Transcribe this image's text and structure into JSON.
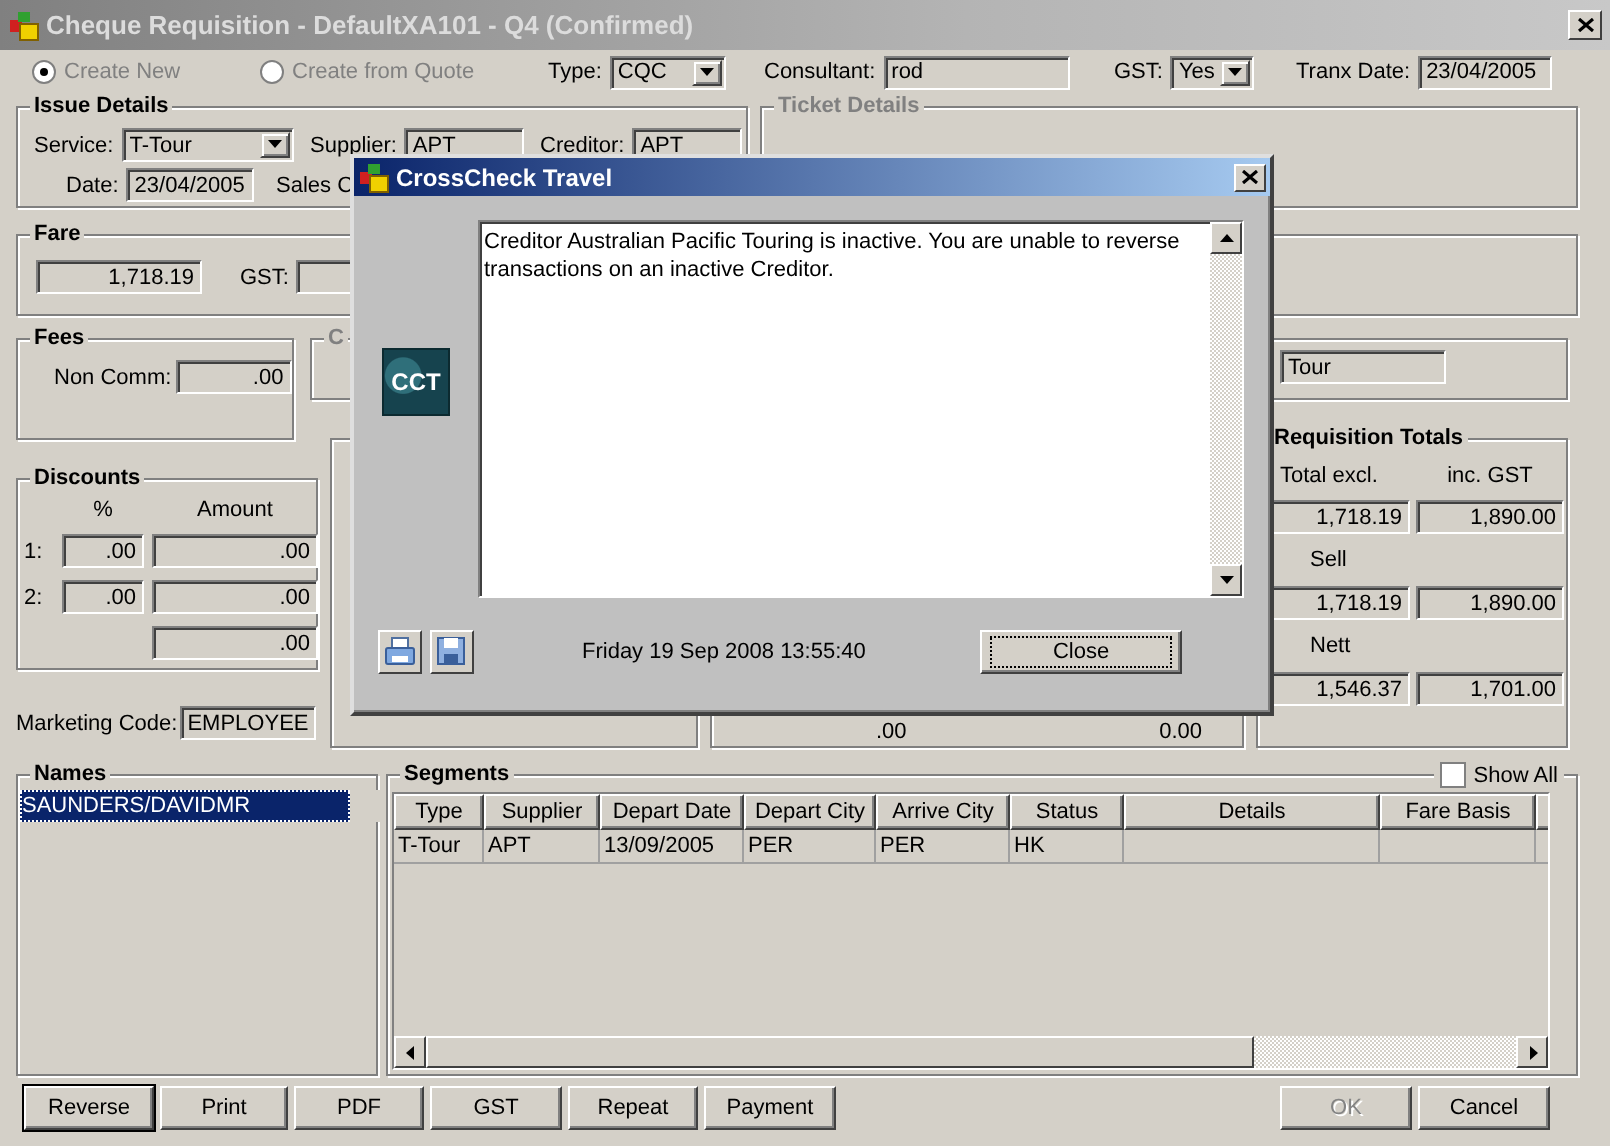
{
  "window": {
    "title": "Cheque Requisition - DefaultXA101 - Q4 (Confirmed)"
  },
  "mode_options": [
    {
      "label": "Create New",
      "selected": true
    },
    {
      "label": "Create from Quote",
      "selected": false
    }
  ],
  "header_fields": [
    {
      "label": "Type:",
      "value": "CQC",
      "kind": "dropdown"
    },
    {
      "label": "Consultant:",
      "value": "rod",
      "kind": "text"
    },
    {
      "label": "GST:",
      "value": "Yes",
      "kind": "dropdown"
    },
    {
      "label": "Tranx Date:",
      "value": "23/04/2005",
      "kind": "text"
    }
  ],
  "issue_details": {
    "title": "Issue Details",
    "rows": [
      [
        {
          "label": "Service:",
          "value": "T-Tour",
          "kind": "dropdown"
        },
        {
          "label": "Supplier:",
          "value": "APT",
          "kind": "text"
        },
        {
          "label": "Creditor:",
          "value": "APT",
          "kind": "text"
        }
      ],
      [
        {
          "label": "Date:",
          "value": "23/04/2005",
          "kind": "text"
        },
        {
          "label": "Sales C",
          "kind": "label"
        }
      ]
    ]
  },
  "ticket_details": {
    "title": "Ticket Details"
  },
  "fare": {
    "title": "Fare",
    "amount": "1,718.19",
    "gst_label": "GST:"
  },
  "fees": {
    "title": "Fees",
    "label": "Non Comm:",
    "value": ".00"
  },
  "section_c": {
    "title": "C",
    "value": "Tour"
  },
  "discounts": {
    "title": "Discounts",
    "columns": [
      "%",
      "Amount"
    ],
    "rows": [
      {
        "label": "1:",
        "percent": ".00",
        "amount": ".00"
      },
      {
        "label": "2:",
        "percent": ".00",
        "amount": ".00"
      }
    ],
    "total": ".00"
  },
  "middle_panel": {
    "values": [
      ".00",
      "0.00"
    ]
  },
  "marketing_code": {
    "label": "Marketing Code:",
    "value": "EMPLOYEE"
  },
  "requisition_totals": {
    "title": "Requisition Totals",
    "columns": [
      "Total excl.",
      "inc. GST"
    ],
    "rows": [
      {
        "values": [
          "1,718.19",
          "1,890.00"
        ]
      },
      {
        "label": "Sell",
        "values": [
          "1,718.19",
          "1,890.00"
        ]
      },
      {
        "label": "Nett",
        "values": [
          "1,546.37",
          "1,701.00"
        ]
      }
    ]
  },
  "names": {
    "title": "Names",
    "items": [
      {
        "label": "SAUNDERS/DAVIDMR",
        "selected": true
      }
    ]
  },
  "segments": {
    "title": "Segments",
    "show_all": {
      "label": "Show All",
      "checked": false
    },
    "columns": [
      "Type",
      "Supplier",
      "Depart Date",
      "Depart City",
      "Arrive City",
      "Status",
      "Details",
      "Fare Basis"
    ],
    "rows": [
      [
        "T-Tour",
        "APT",
        "13/09/2005",
        "PER",
        "PER",
        "HK"
      ]
    ]
  },
  "buttons_left": [
    {
      "label": "Reverse",
      "default": true,
      "disabled": false
    },
    {
      "label": "Print",
      "default": false,
      "disabled": false
    },
    {
      "label": "PDF",
      "default": false,
      "disabled": false
    },
    {
      "label": "GST",
      "default": false,
      "disabled": false
    },
    {
      "label": "Repeat",
      "default": false,
      "disabled": false
    },
    {
      "label": "Payment",
      "default": false,
      "disabled": false
    }
  ],
  "buttons_right": [
    {
      "label": "OK",
      "default": false,
      "disabled": true
    },
    {
      "label": "Cancel",
      "default": false,
      "disabled": false
    }
  ],
  "dialog": {
    "title": "CrossCheck Travel",
    "logo": "CCT",
    "message": "Creditor Australian Pacific Touring is inactive. You are unable to reverse transactions on an inactive Creditor.",
    "timestamp": "Friday 19 Sep 2008 13:55:40",
    "close_label": "Close"
  }
}
